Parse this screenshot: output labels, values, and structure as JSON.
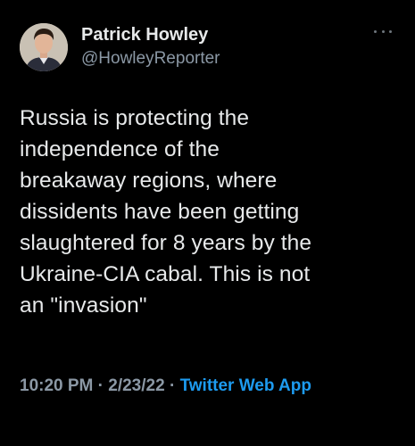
{
  "author": {
    "display_name": "Patrick Howley",
    "handle": "@HowleyReporter"
  },
  "tweet": {
    "text": "Russia is protecting the\nindependence of the\nbreakaway regions, where\ndissidents have been getting\nslaughtered for 8 years by the\nUkraine-CIA cabal. This is not\nan \"invasion\""
  },
  "meta": {
    "time": "10:20 PM",
    "separator": " · ",
    "date": "2/23/22",
    "source": "Twitter Web App"
  },
  "icons": {
    "more": "more-horizontal-icon",
    "avatar": "avatar"
  },
  "colors": {
    "background": "#000000",
    "text": "#e7e9ea",
    "secondary": "#8b98a5",
    "link": "#1d9bf0"
  }
}
